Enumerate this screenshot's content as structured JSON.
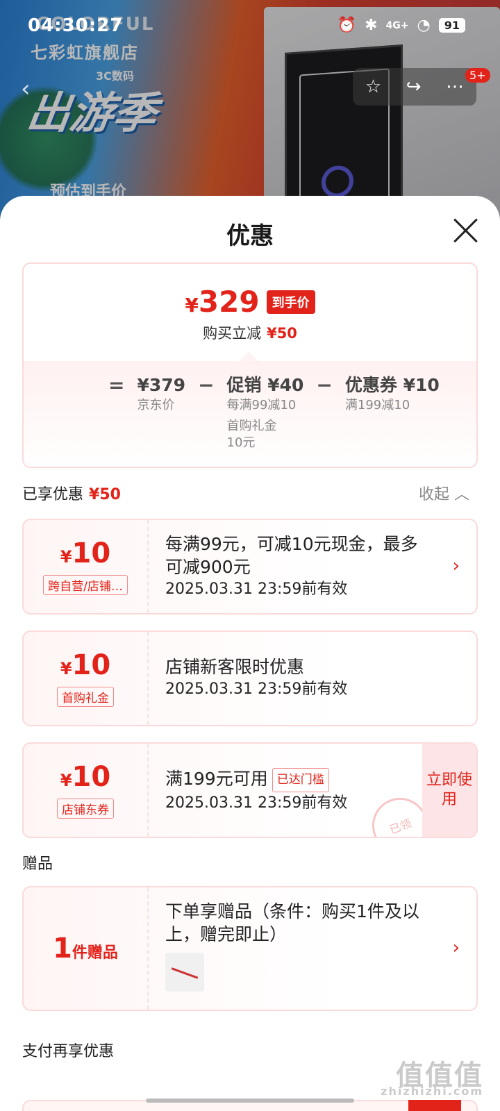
{
  "status_bar": {
    "time": "04:30:27",
    "signal": "4G+",
    "battery": "91"
  },
  "banner": {
    "brand": "COLORFUL",
    "store": "七彩虹旗舰店",
    "subtitle": "3C数码",
    "season": "出游季",
    "estimate": "预估到手价"
  },
  "nav": {
    "badge": "5+"
  },
  "sheet": {
    "title": "优惠"
  },
  "price_card": {
    "final_price": "329",
    "currency": "¥",
    "final_tag": "到手价",
    "reduce_label": "购买立减",
    "reduce_amount": "¥50",
    "formula": {
      "eq": "=",
      "jd_price": "¥379",
      "jd_label": "京东价",
      "minus1": "−",
      "promo": "促销 ¥40",
      "promo_sub1": "每满99减10",
      "promo_sub2": "首购礼金",
      "promo_sub3": "10元",
      "minus2": "−",
      "coupon": "优惠券 ¥10",
      "coupon_sub": "满199减10"
    }
  },
  "enjoyed": {
    "label": "已享优惠",
    "amount": "¥50",
    "collapse": "收起"
  },
  "coupons": [
    {
      "amount": "10",
      "tag": "跨自营/店铺…",
      "desc": "每满99元，可减10元现金，最多可减900元",
      "date": "2025.03.31 23:59前有效"
    },
    {
      "amount": "10",
      "tag": "首购礼金",
      "desc": "店铺新客限时优惠",
      "date": "2025.03.31 23:59前有效"
    },
    {
      "amount": "10",
      "tag": "店铺东券",
      "desc": "满199元可用",
      "reach_tag": "已达门槛",
      "date": "2025.03.31 23:59前有效",
      "use_btn": "立即使用",
      "stamp": "已领"
    }
  ],
  "gift_section": {
    "title": "赠品",
    "count": "1",
    "unit": "件赠品",
    "desc": "下单享赠品（条件：购买1件及以上，赠完即止）"
  },
  "pay_section": {
    "title": "支付再享优惠"
  },
  "watermark": {
    "main": "值值值",
    "sub": "zhizhizhi.com"
  },
  "colors": {
    "accent": "#e2231a",
    "border": "#fbdada"
  }
}
